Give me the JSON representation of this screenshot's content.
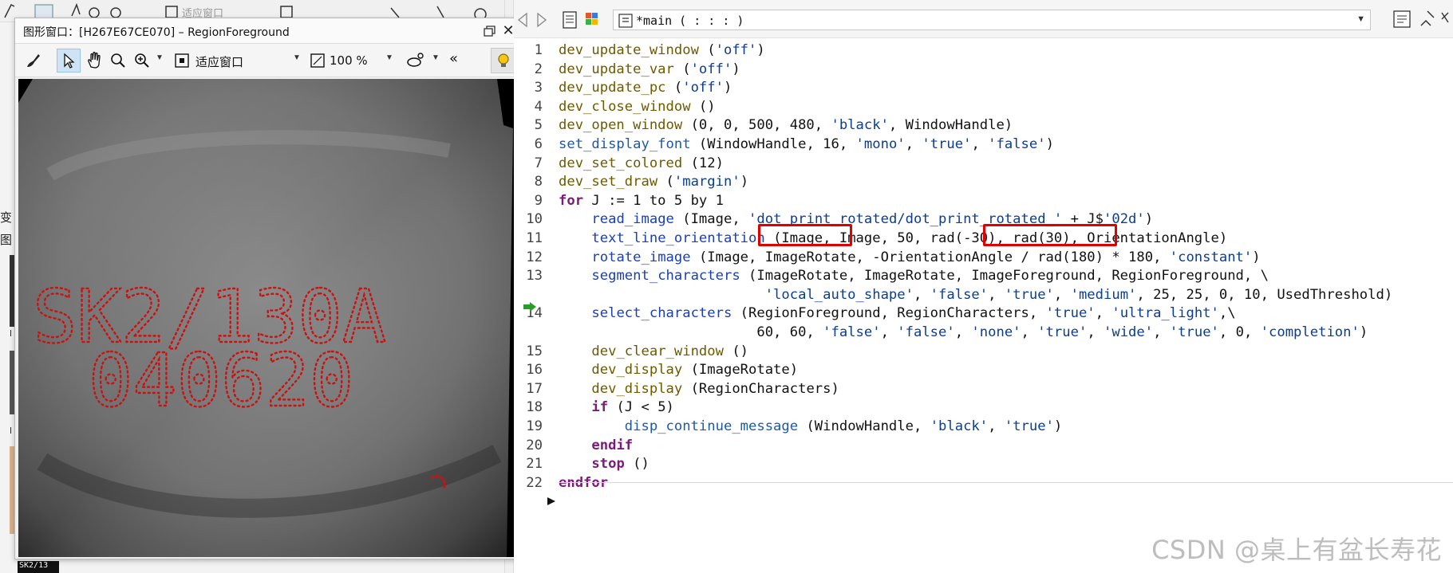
{
  "graphics_window": {
    "title": "图形窗口：[H267E67CE070] – RegionForeground",
    "toolbar": {
      "fit_label": "适应窗口",
      "zoom_label": "100 %",
      "collapse_label": "«"
    },
    "overlay_text_row1": "SK2/130A",
    "overlay_text_row2": "040620"
  },
  "background": {
    "left_labels": [
      "变",
      "图",
      "l",
      "l"
    ],
    "bottom_label": "SK2/13",
    "toolbar_label": "适应窗口"
  },
  "editor": {
    "procedure_label": "*main ( : : : )",
    "lines": [
      {
        "n": "1",
        "tokens": [
          [
            "c-proc",
            "dev_update_window"
          ],
          [
            "c-var",
            " ("
          ],
          [
            "c-str",
            "'off'"
          ],
          [
            "c-var",
            ")"
          ]
        ]
      },
      {
        "n": "2",
        "tokens": [
          [
            "c-proc",
            "dev_update_var"
          ],
          [
            "c-var",
            " ("
          ],
          [
            "c-str",
            "'off'"
          ],
          [
            "c-var",
            ")"
          ]
        ]
      },
      {
        "n": "3",
        "tokens": [
          [
            "c-proc",
            "dev_update_pc"
          ],
          [
            "c-var",
            " ("
          ],
          [
            "c-str",
            "'off'"
          ],
          [
            "c-var",
            ")"
          ]
        ]
      },
      {
        "n": "4",
        "tokens": [
          [
            "c-proc",
            "dev_close_window"
          ],
          [
            "c-var",
            " ()"
          ]
        ]
      },
      {
        "n": "5",
        "tokens": [
          [
            "c-proc",
            "dev_open_window"
          ],
          [
            "c-var",
            " (0, 0, 500, 480, "
          ],
          [
            "c-str",
            "'black'"
          ],
          [
            "c-var",
            ", WindowHandle)"
          ]
        ]
      },
      {
        "n": "6",
        "tokens": [
          [
            "c-bi",
            "set_display_font"
          ],
          [
            "c-var",
            " (WindowHandle, 16, "
          ],
          [
            "c-str",
            "'mono'"
          ],
          [
            "c-var",
            ", "
          ],
          [
            "c-str",
            "'true'"
          ],
          [
            "c-var",
            ", "
          ],
          [
            "c-str",
            "'false'"
          ],
          [
            "c-var",
            ")"
          ]
        ]
      },
      {
        "n": "7",
        "tokens": [
          [
            "c-proc",
            "dev_set_colored"
          ],
          [
            "c-var",
            " (12)"
          ]
        ]
      },
      {
        "n": "8",
        "tokens": [
          [
            "c-proc",
            "dev_set_draw"
          ],
          [
            "c-var",
            " ("
          ],
          [
            "c-str",
            "'margin'"
          ],
          [
            "c-var",
            ")"
          ]
        ]
      },
      {
        "n": "9",
        "tokens": [
          [
            "c-kw",
            "for"
          ],
          [
            "c-var",
            " J := 1 to 5 by 1"
          ]
        ]
      },
      {
        "n": "10",
        "tokens": [
          [
            "c-var",
            "    "
          ],
          [
            "c-op",
            "read_image"
          ],
          [
            "c-var",
            " (Image, "
          ],
          [
            "c-str",
            "'dot_print_rotated/dot_print_rotated_'"
          ],
          [
            "c-var",
            " + J$"
          ],
          [
            "c-str",
            "'02d'"
          ],
          [
            "c-var",
            ")"
          ]
        ]
      },
      {
        "n": "11",
        "tokens": [
          [
            "c-var",
            "    "
          ],
          [
            "c-op",
            "text_line_orientation"
          ],
          [
            "c-var",
            " (Image, Image, 50, rad(-30), rad(30), OrientationAngle)"
          ]
        ]
      },
      {
        "n": "12",
        "tokens": [
          [
            "c-var",
            "    "
          ],
          [
            "c-op",
            "rotate_image"
          ],
          [
            "c-var",
            " (Image, ImageRotate, -OrientationAngle / rad(180) * 180, "
          ],
          [
            "c-str",
            "'constant'"
          ],
          [
            "c-var",
            ")"
          ]
        ]
      },
      {
        "n": "13",
        "tokens": [
          [
            "c-var",
            "    "
          ],
          [
            "c-op",
            "segment_characters"
          ],
          [
            "c-var",
            " (ImageRotate, ImageRotate, ImageForeground, RegionForeground, \\"
          ]
        ]
      },
      {
        "n": "",
        "tokens": [
          [
            "c-var",
            "                         "
          ],
          [
            "c-str",
            "'local_auto_shape'"
          ],
          [
            "c-var",
            ", "
          ],
          [
            "c-str",
            "'false'"
          ],
          [
            "c-var",
            ", "
          ],
          [
            "c-str",
            "'true'"
          ],
          [
            "c-var",
            ", "
          ],
          [
            "c-str",
            "'medium'"
          ],
          [
            "c-var",
            ", 25, 25, 0, 10, UsedThreshold)"
          ]
        ]
      },
      {
        "n": "14",
        "tokens": [
          [
            "c-var",
            "    "
          ],
          [
            "c-op",
            "select_characters"
          ],
          [
            "c-var",
            " (RegionForeground, RegionCharacters, "
          ],
          [
            "c-str",
            "'true'"
          ],
          [
            "c-var",
            ", "
          ],
          [
            "c-str",
            "'ultra_light'"
          ],
          [
            "c-var",
            ",\\"
          ]
        ]
      },
      {
        "n": "",
        "tokens": [
          [
            "c-var",
            "                        60, 60, "
          ],
          [
            "c-str",
            "'false'"
          ],
          [
            "c-var",
            ", "
          ],
          [
            "c-str",
            "'false'"
          ],
          [
            "c-var",
            ", "
          ],
          [
            "c-str",
            "'none'"
          ],
          [
            "c-var",
            ", "
          ],
          [
            "c-str",
            "'true'"
          ],
          [
            "c-var",
            ", "
          ],
          [
            "c-str",
            "'wide'"
          ],
          [
            "c-var",
            ", "
          ],
          [
            "c-str",
            "'true'"
          ],
          [
            "c-var",
            ", 0, "
          ],
          [
            "c-str",
            "'completion'"
          ],
          [
            "c-var",
            ")"
          ]
        ]
      },
      {
        "n": "15",
        "tokens": [
          [
            "c-var",
            "    "
          ],
          [
            "c-proc",
            "dev_clear_window"
          ],
          [
            "c-var",
            " ()"
          ]
        ]
      },
      {
        "n": "16",
        "tokens": [
          [
            "c-var",
            "    "
          ],
          [
            "c-proc",
            "dev_display"
          ],
          [
            "c-var",
            " (ImageRotate)"
          ]
        ]
      },
      {
        "n": "17",
        "tokens": [
          [
            "c-var",
            "    "
          ],
          [
            "c-proc",
            "dev_display"
          ],
          [
            "c-var",
            " (RegionCharacters)"
          ]
        ]
      },
      {
        "n": "18",
        "tokens": [
          [
            "c-var",
            "    "
          ],
          [
            "c-kw",
            "if"
          ],
          [
            "c-var",
            " (J < 5)"
          ]
        ]
      },
      {
        "n": "19",
        "tokens": [
          [
            "c-var",
            "        "
          ],
          [
            "c-bi",
            "disp_continue_message"
          ],
          [
            "c-var",
            " (WindowHandle, "
          ],
          [
            "c-str",
            "'black'"
          ],
          [
            "c-var",
            ", "
          ],
          [
            "c-str",
            "'true'"
          ],
          [
            "c-var",
            ")"
          ]
        ]
      },
      {
        "n": "20",
        "tokens": [
          [
            "c-var",
            "    "
          ],
          [
            "c-kw",
            "endif"
          ]
        ]
      },
      {
        "n": "21",
        "tokens": [
          [
            "c-var",
            "    "
          ],
          [
            "c-kw",
            "stop"
          ],
          [
            "c-var",
            " ()"
          ]
        ]
      },
      {
        "n": "22",
        "tokens": [
          [
            "c-kw",
            "endfor"
          ]
        ]
      }
    ]
  },
  "highlights": [
    "ImageRotate",
    "RegionForeground"
  ],
  "watermark": "CSDN @桌上有盆长寿花",
  "colors": {
    "highlight": "#e00000",
    "overlay": "#cc1111"
  }
}
